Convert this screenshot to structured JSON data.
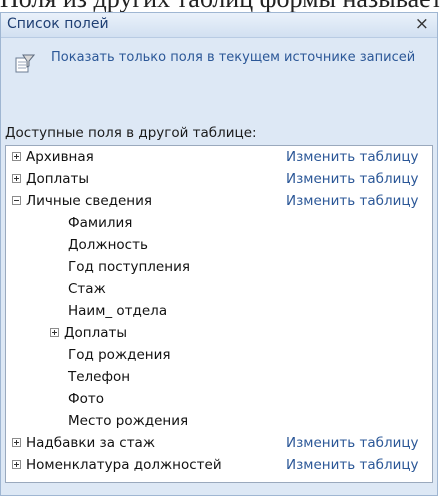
{
  "cut_heading": "Поля из других таблиц формы называется списком…",
  "panel": {
    "title": "Список полей",
    "close": "×",
    "show_only_current": "Показать только поля в текущем источнике записей",
    "available_label": "Доступные поля в другой таблице:",
    "edit_label": "Изменить таблицу"
  },
  "tree": {
    "t1": "Архивная",
    "t2": "Доплаты",
    "t3": "Личные сведения",
    "f1": "Фамилия",
    "f2": "Должность",
    "f3": "Год поступления",
    "f4": "Стаж",
    "f5": "Наим_ отдела",
    "f6": "Доплаты",
    "f7": "Год рождения",
    "f8": "Телефон",
    "f9": "Фото",
    "f10": "Место рождения",
    "t4": "Надбавки за стаж",
    "t5": "Номенклатура должностей"
  }
}
